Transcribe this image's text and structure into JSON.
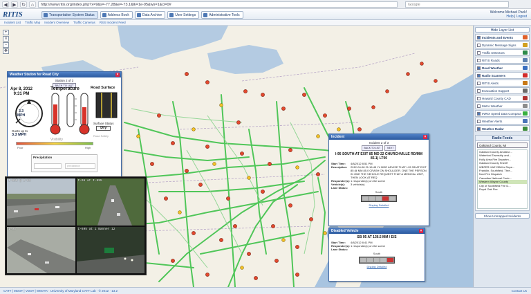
{
  "browser": {
    "url": "http://www.ritis.org/index.php?x=9&s=-77.28&e=-73.1&lk=1e-05&ws=1&ci=0#",
    "search_placeholder": "Google"
  },
  "app": {
    "logo": "RITIS",
    "tabs": [
      {
        "label": "Transportation System Status",
        "active": true
      },
      {
        "label": "Address Book",
        "active": false
      },
      {
        "label": "Data Archive",
        "active": false
      },
      {
        "label": "User Settings",
        "active": false
      },
      {
        "label": "Administrative Tools",
        "active": false
      }
    ],
    "user": {
      "welcome": "Welcome Michael Pack!",
      "help": "Help",
      "logout": "Logout"
    },
    "subnav": [
      "Incident List",
      "Traffic Map",
      "Incident Overview",
      "Traffic Cameras",
      "RSS Incident Feed"
    ]
  },
  "weather_panel": {
    "title": "Weather Station for Road City",
    "pager": "Station 2 of 3",
    "back": "BACK TO LIST",
    "date": "Apr 8, 2012",
    "time": "9:31 PM",
    "temp_title": "Temperature",
    "road_title": "Road Surface",
    "wind_speed": "3.3",
    "wind_unit": "MPH",
    "gusts_label": "Gusts up to",
    "gusts_value": "3.3 MPH",
    "surface_label": "Surface Status",
    "surface_value": "Dry",
    "safety_label": "Road Safety",
    "visibility_title": "Visibility",
    "vis_poor": "Poor",
    "vis_high": "High",
    "precip_title": "Precipitation",
    "precip_placeholder": "precipitation"
  },
  "cameras": [
    {
      "caption": "I-695 @ I-83"
    },
    {
      "caption": "I-95 at I-895"
    },
    {
      "caption": "I-95"
    },
    {
      "caption": "I-695 at 1 Banner 12"
    }
  ],
  "incident_panel": {
    "title": "Incident",
    "pager": "Incident 2 of 3",
    "back": "BACK TO LIST",
    "next": "NEXT",
    "headline": "I-95 SOUTH AT EXIT 85 MD 22 CHURCHVILLE RD/MM 85.1) LT00",
    "rows": [
      {
        "key": "Start Time:",
        "value": "4/8/2012 8:51 PM"
      },
      {
        "key": "Description:",
        "value": "2012-04-08 21:16:45 Y4 MDE ADVISE THAT I-95 SB AT EXIT 85 @ MM 85.0 CRASH ON SHOULDER. ONE THE PERSON IN ONE THE VEHICLE REQUEST THAT A MEDICAL UNIT, THEN LOOK AT REQ"
      },
      {
        "key": "Responder(s):",
        "value": "1 responder(s) on the scene"
      },
      {
        "key": "Vehicle(s):",
        "value": "3 vehicle(s)"
      },
      {
        "key": "Lane Status:",
        "value": ""
      }
    ],
    "lane_dir": "South",
    "display_link": "Display Detailed"
  },
  "disabled_panel": {
    "title": "Disabled Vehicle",
    "headline": "SB 95 AT 136.5 MM / E/S",
    "rows": [
      {
        "key": "Start Time:",
        "value": "4/8/2012 8:41 PM"
      },
      {
        "key": "Responder(s):",
        "value": "1 responder(s) on the scene"
      },
      {
        "key": "Lane Status:",
        "value": ""
      }
    ],
    "lane_dir": "South",
    "display_link": "Display Detailed"
  },
  "sidebar": {
    "hide_label": "Hide Layer List",
    "layers": [
      {
        "label": "Incidents and Events",
        "on": true,
        "bold": true,
        "color": "#e0602a"
      },
      {
        "label": "Dynamic Message Signs",
        "on": false,
        "bold": false,
        "color": "#d2a020"
      },
      {
        "label": "Traffic Detectors",
        "on": false,
        "bold": false,
        "color": "#2c8a4a"
      },
      {
        "label": "RITIS Roads",
        "on": false,
        "bold": false,
        "color": "#5a7fb0"
      },
      {
        "label": "Road Weather",
        "on": true,
        "bold": true,
        "color": "#3a6fc0"
      },
      {
        "label": "Radio Scanners",
        "on": true,
        "bold": true,
        "color": "#d22a2a"
      },
      {
        "label": "RITIS Alerts",
        "on": false,
        "bold": false,
        "color": "#c97a18"
      },
      {
        "label": "Evacuation Support",
        "on": false,
        "bold": false,
        "color": "#6a6a6a"
      },
      {
        "label": "Howard County CAD",
        "on": false,
        "bold": false,
        "color": "#b03030"
      },
      {
        "label": "Metro Weather",
        "on": false,
        "bold": false,
        "color": "#8c8c8c"
      },
      {
        "label": "INRIX Speed Data Comparative Speed",
        "on": true,
        "bold": false,
        "color": "#38b040"
      },
      {
        "label": "Weather Alerts",
        "on": false,
        "bold": false,
        "color": "#4a74b8"
      },
      {
        "label": "Weather Radar",
        "on": true,
        "bold": true,
        "color": "#3c8c3c"
      }
    ],
    "radio_title": "Radio Feeds",
    "radio_selected": "Oakland County, MI",
    "radio_feeds": [
      "Oakland County Amateur...",
      "Waterford Township and...",
      "Holly Area Fire Departm...",
      "Oakland County Sheriff",
      "WBFER HAZ 25MHz Repe...",
      "Franklin, Southfield, Thre...",
      "Novi Fire Dispatch",
      "Canadian National Centr...",
      "Western Wayne County",
      "City of Southfield Fire D...",
      "Royal Oak Fire"
    ],
    "radio_highlight": 8,
    "unmapped_label": "Show Unmapped Incidents"
  },
  "footer": {
    "left": "CATT | MDOT | VDOT | WMATA · University of Maryland CATT Lab · © 2012 · 13.2",
    "right": "Contact Us"
  }
}
